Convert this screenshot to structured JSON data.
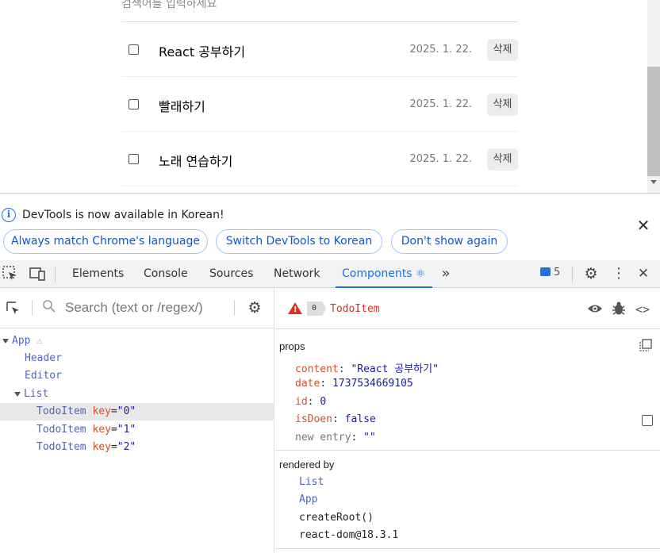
{
  "page": {
    "search_placeholder": "검색어를 입력하세요",
    "todos": [
      {
        "content": "React 공부하기",
        "date": "2025. 1. 22.",
        "delete_label": "삭제"
      },
      {
        "content": "빨래하기",
        "date": "2025. 1. 22.",
        "delete_label": "삭제"
      },
      {
        "content": "노래 연습하기",
        "date": "2025. 1. 22.",
        "delete_label": "삭제"
      }
    ]
  },
  "devtools": {
    "infobar": {
      "message": "DevTools is now available in Korean!",
      "buttons": [
        "Always match Chrome's language",
        "Switch DevTools to Korean",
        "Don't show again"
      ]
    },
    "tabs": [
      "Elements",
      "Console",
      "Sources",
      "Network",
      "Components ⚛"
    ],
    "active_tab": "Components ⚛",
    "message_count": "5",
    "components": {
      "search_placeholder": "Search (text or /regex/)",
      "tree": [
        {
          "name": "App"
        },
        {
          "name": "Header"
        },
        {
          "name": "Editor"
        },
        {
          "name": "List"
        },
        {
          "name": "TodoItem",
          "key_attr": "key",
          "key_value": "\"0\""
        },
        {
          "name": "TodoItem",
          "key_attr": "key",
          "key_value": "\"1\""
        },
        {
          "name": "TodoItem",
          "key_attr": "key",
          "key_value": "\"2\""
        }
      ],
      "selected": {
        "key_badge": "0",
        "name": "TodoItem",
        "props_title": "props",
        "props": [
          {
            "key": "content",
            "value": "\"React 공부하기\""
          },
          {
            "key": "date",
            "value": "1737534669105"
          },
          {
            "key": "id",
            "value": "0"
          },
          {
            "key": "isDoen",
            "value": "false"
          },
          {
            "key": "new entry",
            "value": "\"\""
          }
        ],
        "rendered_by_title": "rendered by",
        "rendered_by": [
          "List",
          "App",
          "createRoot()",
          "react-dom@18.3.1"
        ]
      }
    }
  }
}
